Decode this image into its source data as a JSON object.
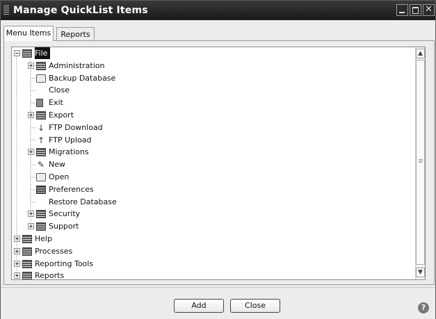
{
  "window": {
    "title": "Manage QuickList Items"
  },
  "tabs": [
    {
      "label": "Menu Items",
      "active": true
    },
    {
      "label": "Reports",
      "active": false
    }
  ],
  "tree": {
    "items": [
      {
        "label": "File",
        "level": 0,
        "expander": "minus",
        "icon": "folder-icon",
        "selected": true
      },
      {
        "label": "Administration",
        "level": 1,
        "expander": "plus",
        "icon": "folder-icon"
      },
      {
        "label": "Backup Database",
        "level": 1,
        "expander": "none",
        "icon": "backup-icon"
      },
      {
        "label": "Close",
        "level": 1,
        "expander": "none",
        "icon": ""
      },
      {
        "label": "Exit",
        "level": 1,
        "expander": "none",
        "icon": "exit-icon"
      },
      {
        "label": "Export",
        "level": 1,
        "expander": "plus",
        "icon": "folder-icon"
      },
      {
        "label": "FTP Download",
        "level": 1,
        "expander": "none",
        "icon": "download-icon"
      },
      {
        "label": "FTP Upload",
        "level": 1,
        "expander": "none",
        "icon": "upload-icon"
      },
      {
        "label": "Migrations",
        "level": 1,
        "expander": "plus",
        "icon": "folder-icon"
      },
      {
        "label": "New",
        "level": 1,
        "expander": "none",
        "icon": "new-icon"
      },
      {
        "label": "Open",
        "level": 1,
        "expander": "none",
        "icon": "open-icon"
      },
      {
        "label": "Preferences",
        "level": 1,
        "expander": "none",
        "icon": "preferences-icon"
      },
      {
        "label": "Restore Database",
        "level": 1,
        "expander": "none",
        "icon": ""
      },
      {
        "label": "Security",
        "level": 1,
        "expander": "plus",
        "icon": "folder-icon"
      },
      {
        "label": "Support",
        "level": 1,
        "expander": "plus",
        "icon": "folder-icon"
      },
      {
        "label": "Help",
        "level": 0,
        "expander": "plus",
        "icon": "folder-icon"
      },
      {
        "label": "Processes",
        "level": 0,
        "expander": "plus",
        "icon": "folder-icon"
      },
      {
        "label": "Reporting Tools",
        "level": 0,
        "expander": "plus",
        "icon": "folder-icon"
      },
      {
        "label": "Reports",
        "level": 0,
        "expander": "plus",
        "icon": "folder-icon"
      }
    ]
  },
  "footer": {
    "add_label": "Add",
    "close_label": "Close"
  },
  "colors": {
    "titlebar": "#1a1a1a",
    "selection": "#111111"
  }
}
